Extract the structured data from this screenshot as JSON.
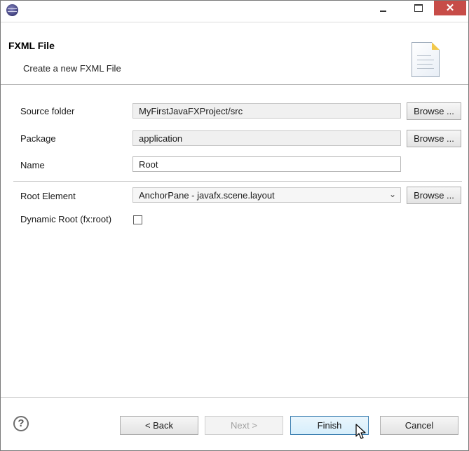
{
  "window": {
    "close_glyph": "✕"
  },
  "header": {
    "title": "FXML File",
    "subtitle": "Create a new FXML File"
  },
  "form": {
    "source_folder": {
      "label": "Source folder",
      "value": "MyFirstJavaFXProject/src",
      "browse": "Browse ..."
    },
    "package": {
      "label": "Package",
      "value": "application",
      "browse": "Browse ..."
    },
    "name": {
      "label": "Name",
      "value": "Root"
    },
    "root_element": {
      "label": "Root Element",
      "value": "AnchorPane - javafx.scene.layout",
      "browse": "Browse ..."
    },
    "dynamic_root": {
      "label": "Dynamic Root (fx:root)",
      "checked": false
    }
  },
  "footer": {
    "help_glyph": "?",
    "back": "< Back",
    "next": "Next >",
    "finish": "Finish",
    "cancel": "Cancel"
  },
  "colors": {
    "close_button": "#c74c48",
    "default_button_border": "#3c7fb1"
  }
}
